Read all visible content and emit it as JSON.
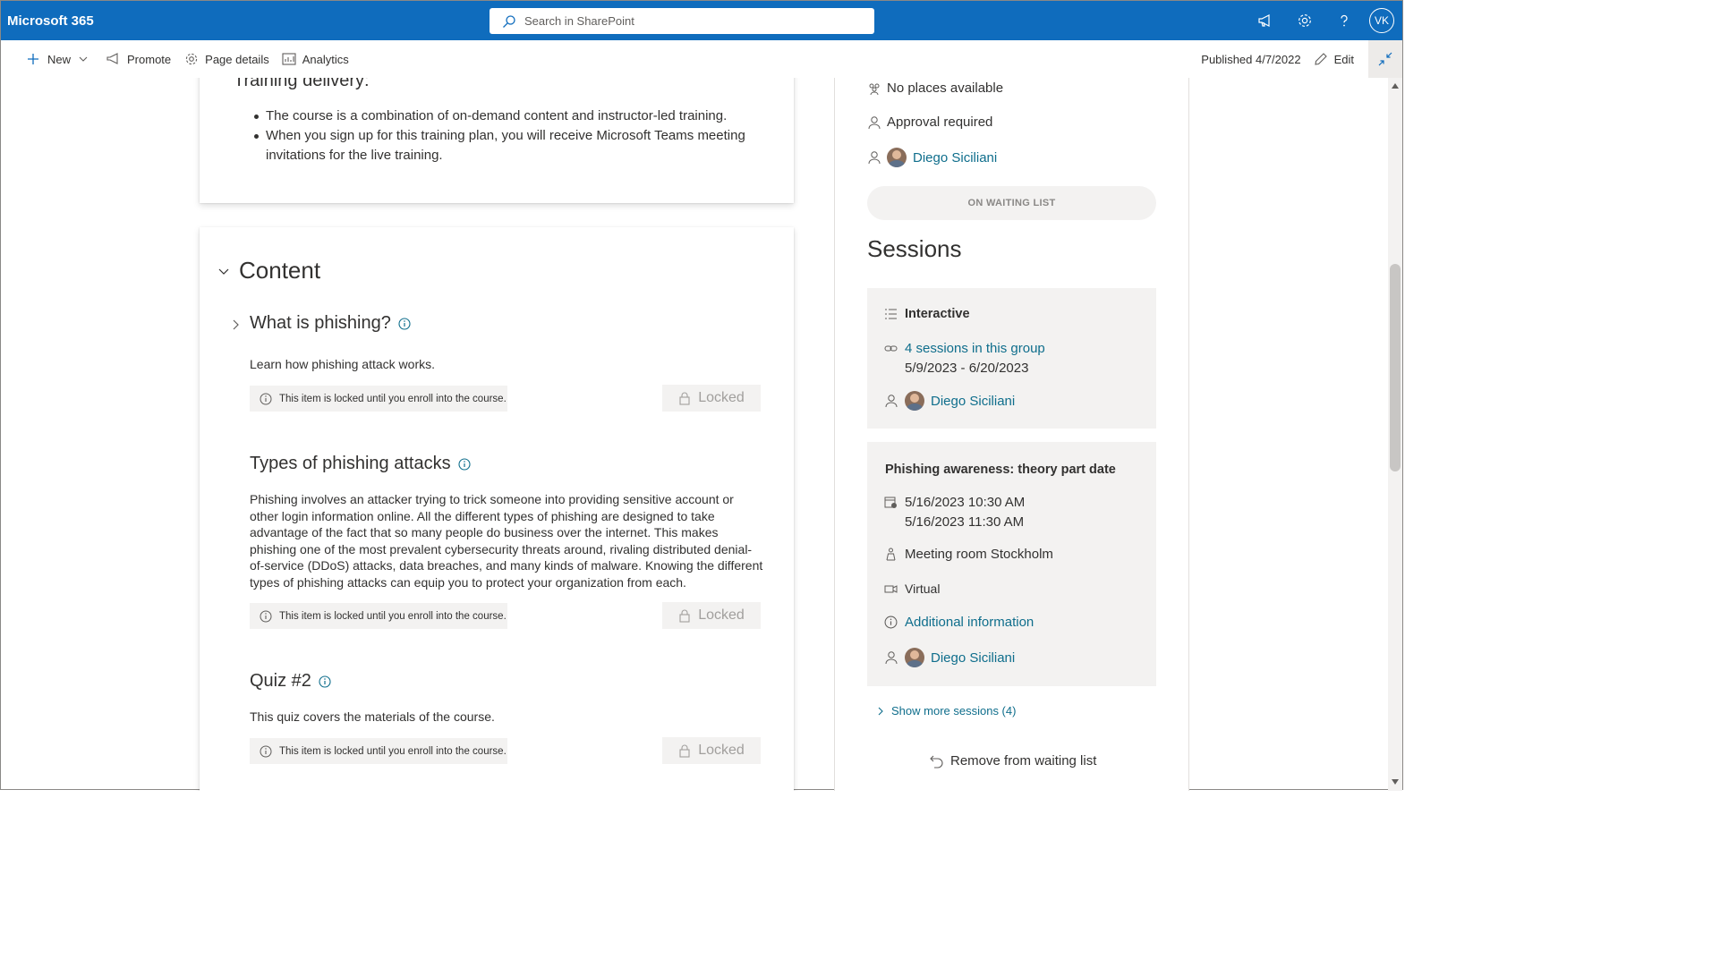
{
  "topbar": {
    "brand": "Microsoft 365",
    "search_placeholder": "Search in SharePoint",
    "avatar_initials": "VK",
    "accent": "#0f6cbd"
  },
  "commandbar": {
    "new_label": "New",
    "promote_label": "Promote",
    "page_details_label": "Page details",
    "analytics_label": "Analytics",
    "published": "Published 4/7/2022",
    "edit_label": "Edit"
  },
  "main": {
    "training_delivery_heading": "Training delivery:",
    "bullets": [
      "The course is a combination of on-demand content and instructor-led training.",
      "When you sign up for this training plan, you will receive Microsoft Teams meeting invitations for the live training."
    ],
    "content_heading": "Content",
    "items": [
      {
        "title": "What is phishing?",
        "description": "Learn how phishing attack works.",
        "locked_note": "This item is locked until you enroll into the course.",
        "locked_label": "Locked"
      },
      {
        "title": "Types of phishing attacks",
        "description": "Phishing involves an attacker trying to trick someone into providing sensitive account or other login information online. All the different types of phishing are designed to take advantage of the fact that so many people do business over the internet. This makes phishing one of the most prevalent cybersecurity threats around, rivaling distributed denial-of-service (DDoS) attacks, data breaches, and many kinds of malware. Knowing the different types of phishing attacks can equip you to protect your organization from each.",
        "locked_note": "This item is locked until you enroll into the course.",
        "locked_label": "Locked"
      },
      {
        "title": "Quiz #2",
        "description": "This quiz covers the materials of the course.",
        "locked_note": "This item is locked until you enroll into the course.",
        "locked_label": "Locked"
      }
    ]
  },
  "sidebar": {
    "places": "No places available",
    "approval": "Approval required",
    "owner": "Diego Siciliani",
    "waiting_button": "ON WAITING LIST",
    "sessions_heading": "Sessions",
    "session1": {
      "title": "Interactive",
      "group_link": "4 sessions in this group",
      "dates": "5/9/2023 - 6/20/2023",
      "trainer": "Diego Siciliani"
    },
    "session2": {
      "title": "Phishing awareness: theory part date",
      "start": "5/16/2023 10:30 AM",
      "end": "5/16/2023 11:30 AM",
      "location": "Meeting room Stockholm",
      "mode": "Virtual",
      "info_link": "Additional information",
      "trainer": "Diego Siciliani"
    },
    "show_more": "Show more sessions (4)",
    "remove_label": "Remove from waiting list"
  }
}
